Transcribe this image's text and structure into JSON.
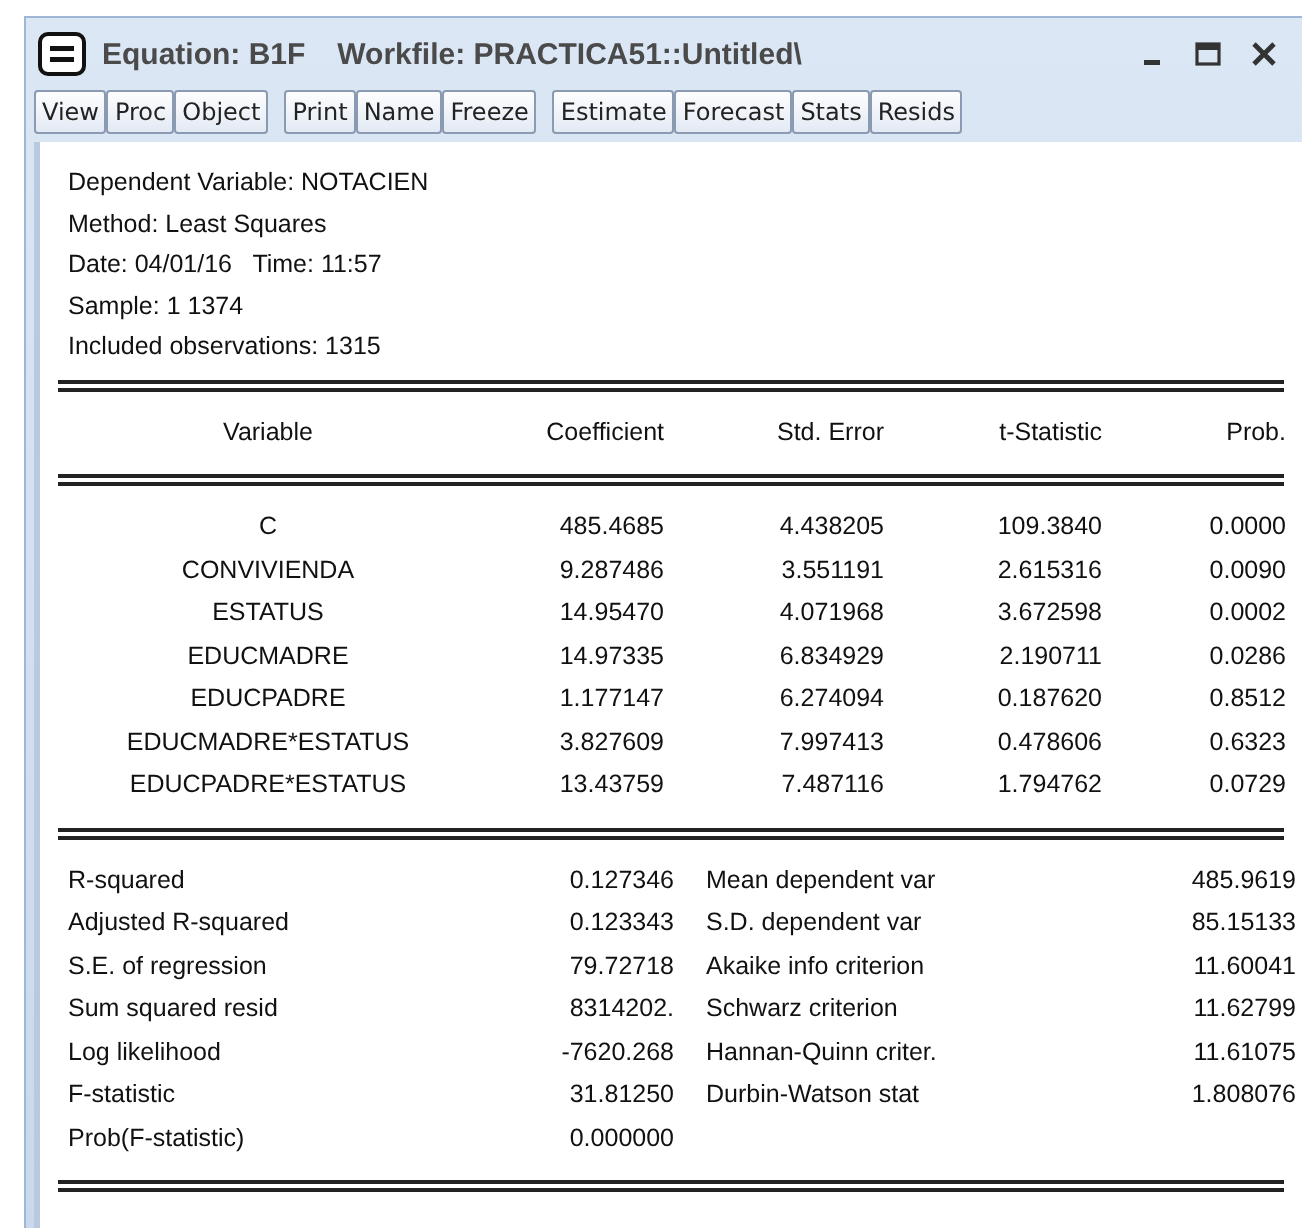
{
  "window": {
    "title": "Equation: B1F",
    "subtitle": "Workfile: PRACTICA51::Untitled\\"
  },
  "toolbar": [
    [
      "View",
      "Proc",
      "Object"
    ],
    [
      "Print",
      "Name",
      "Freeze"
    ],
    [
      "Estimate",
      "Forecast",
      "Stats",
      "Resids"
    ]
  ],
  "header": [
    "Dependent Variable: NOTACIEN",
    "Method: Least Squares",
    "Date: 04/01/16   Time: 11:57",
    "Sample: 1 1374",
    "Included observations: 1315"
  ],
  "table": {
    "columns": [
      "Variable",
      "Coefficient",
      "Std. Error",
      "t-Statistic",
      "Prob."
    ],
    "rows": [
      [
        "C",
        "485.4685",
        "4.438205",
        "109.3840",
        "0.0000"
      ],
      [
        "CONVIVIENDA",
        "9.287486",
        "3.551191",
        "2.615316",
        "0.0090"
      ],
      [
        "ESTATUS",
        "14.95470",
        "4.071968",
        "3.672598",
        "0.0002"
      ],
      [
        "EDUCMADRE",
        "14.97335",
        "6.834929",
        "2.190711",
        "0.0286"
      ],
      [
        "EDUCPADRE",
        "1.177147",
        "6.274094",
        "0.187620",
        "0.8512"
      ],
      [
        "EDUCMADRE*ESTATUS",
        "3.827609",
        "7.997413",
        "0.478606",
        "0.6323"
      ],
      [
        "EDUCPADRE*ESTATUS",
        "13.43759",
        "7.487116",
        "1.794762",
        "0.0729"
      ]
    ]
  },
  "stats": [
    [
      "R-squared",
      "0.127346",
      "Mean dependent var",
      "485.9619"
    ],
    [
      "Adjusted R-squared",
      "0.123343",
      "S.D. dependent var",
      "85.15133"
    ],
    [
      "S.E. of regression",
      "79.72718",
      "Akaike info criterion",
      "11.60041"
    ],
    [
      "Sum squared resid",
      "8314202.",
      "Schwarz criterion",
      "11.62799"
    ],
    [
      "Log likelihood",
      "-7620.268",
      "Hannan-Quinn criter.",
      "11.61075"
    ],
    [
      "F-statistic",
      "31.81250",
      "Durbin-Watson stat",
      "1.808076"
    ],
    [
      "Prob(F-statistic)",
      "0.000000"
    ]
  ]
}
